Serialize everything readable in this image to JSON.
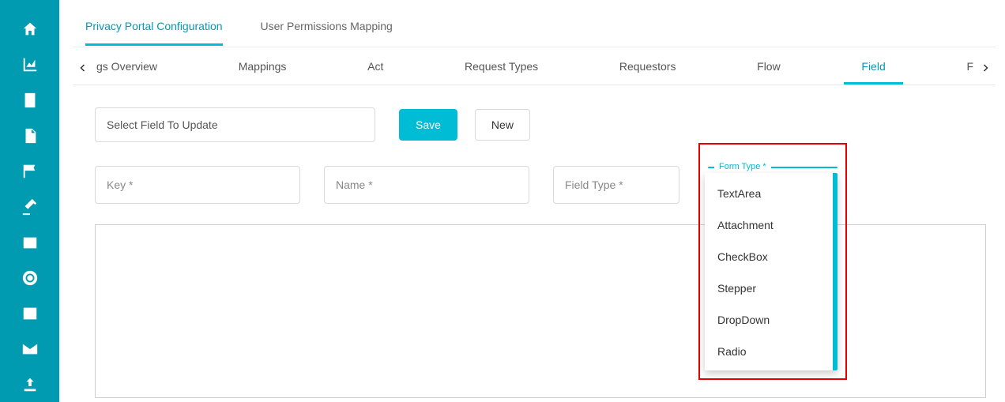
{
  "sidenav": {
    "items": [
      {
        "name": "home-icon"
      },
      {
        "name": "chart-icon"
      },
      {
        "name": "building-icon"
      },
      {
        "name": "file-icon"
      },
      {
        "name": "flag-icon"
      },
      {
        "name": "gavel-icon"
      },
      {
        "name": "inbox-icon"
      },
      {
        "name": "lifebuoy-icon"
      },
      {
        "name": "newspaper-icon"
      },
      {
        "name": "envelope-icon"
      },
      {
        "name": "upload-icon"
      }
    ]
  },
  "top_tabs": {
    "items": [
      {
        "label": "Privacy Portal Configuration",
        "active": true
      },
      {
        "label": "User Permissions Mapping",
        "active": false
      }
    ]
  },
  "sub_tabs": {
    "items": [
      {
        "label": "gs Overview"
      },
      {
        "label": "Mappings"
      },
      {
        "label": "Act"
      },
      {
        "label": "Request Types"
      },
      {
        "label": "Requestors"
      },
      {
        "label": "Flow"
      },
      {
        "label": "Field"
      },
      {
        "label": "F"
      }
    ],
    "active_index": 6
  },
  "toolbar": {
    "select_placeholder": "Select Field To Update",
    "save_label": "Save",
    "new_label": "New"
  },
  "fields": {
    "key_label": "Key *",
    "name_label": "Name *",
    "field_type_label": "Field Type *",
    "form_type_label": "Form Type *"
  },
  "form_type_dropdown": {
    "label": "Form Type *",
    "options": [
      "TextArea",
      "Attachment",
      "CheckBox",
      "Stepper",
      "DropDown",
      "Radio"
    ]
  }
}
